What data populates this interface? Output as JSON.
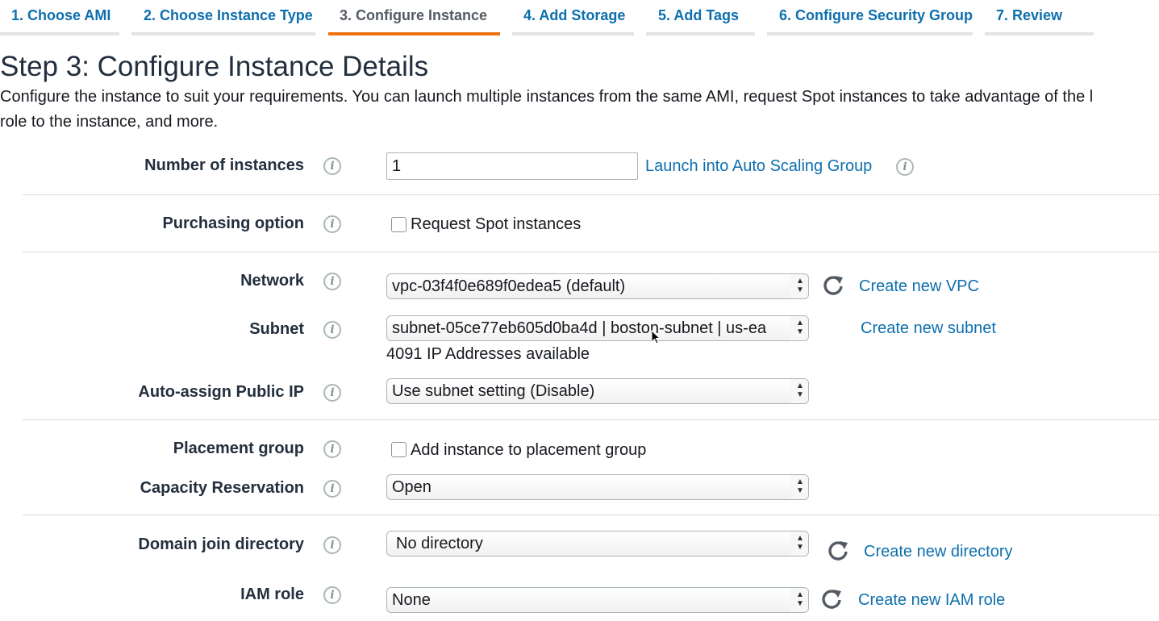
{
  "tabs": [
    {
      "label": "1. Choose AMI"
    },
    {
      "label": "2. Choose Instance Type"
    },
    {
      "label": "3. Configure Instance"
    },
    {
      "label": "4. Add Storage"
    },
    {
      "label": "5. Add Tags"
    },
    {
      "label": "6. Configure Security Group"
    },
    {
      "label": "7. Review"
    }
  ],
  "active_tab": "3. Configure Instance",
  "page": {
    "title": "Step 3: Configure Instance Details",
    "description_line1": "Configure the instance to suit your requirements. You can launch multiple instances from the same AMI, request Spot instances to take advantage of the l",
    "description_line2": "role to the instance, and more."
  },
  "info_glyph": "i",
  "form": {
    "number_of_instances": {
      "label": "Number of instances",
      "value": "1",
      "link": "Launch into Auto Scaling Group"
    },
    "purchasing_option": {
      "label": "Purchasing option",
      "checkbox_label": "Request Spot instances",
      "checked": false
    },
    "network": {
      "label": "Network",
      "value": "vpc-03f4f0e689f0edea5 (default)",
      "link": "Create new VPC"
    },
    "subnet": {
      "label": "Subnet",
      "value": "subnet-05ce77eb605d0ba4d | boston-subnet | us-ea",
      "note": "4091 IP Addresses available",
      "link": "Create new subnet"
    },
    "auto_assign_ip": {
      "label": "Auto-assign Public IP",
      "value": "Use subnet setting (Disable)"
    },
    "placement_group": {
      "label": "Placement group",
      "checkbox_label": "Add instance to placement group",
      "checked": false
    },
    "capacity_reservation": {
      "label": "Capacity Reservation",
      "value": "Open"
    },
    "domain_join": {
      "label": "Domain join directory",
      "value": "No directory",
      "link": "Create new directory"
    },
    "iam_role": {
      "label": "IAM role",
      "value": "None",
      "link": "Create new IAM role"
    }
  },
  "colors": {
    "link": "#0d6fae",
    "active_tab_underline": "#ec7211",
    "tab_underline": "#e4e4e4",
    "separator": "#d5dbdb"
  },
  "icons": {
    "info": "info-icon",
    "refresh": "refresh-icon",
    "select_arrows": "updown-arrows-icon"
  }
}
